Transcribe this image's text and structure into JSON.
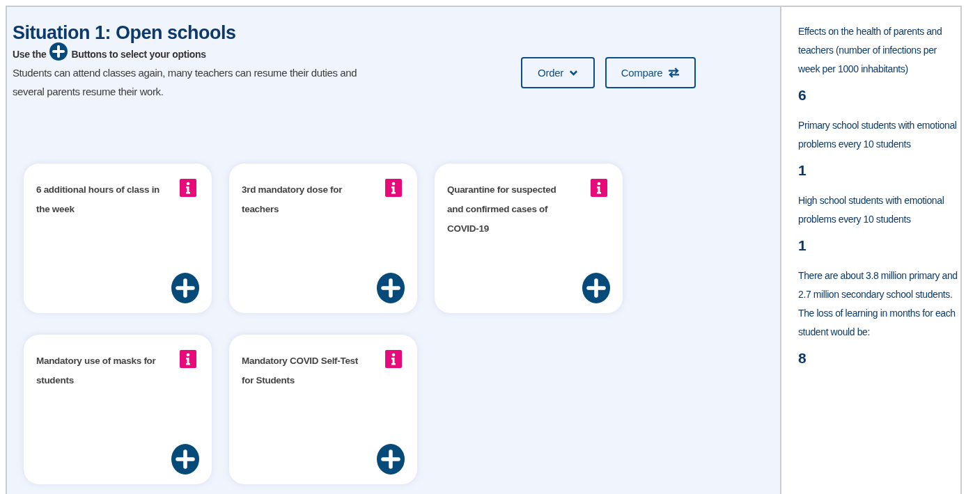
{
  "heading": "Situation 1: Open schools",
  "instruction": {
    "before": "Use the",
    "after": "Buttons to select your options"
  },
  "description": "Students can attend classes again, many teachers can resume their duties and several parents resume their work.",
  "buttons": [
    {
      "label": "Order",
      "kind": "dropdown"
    },
    {
      "label": "Compare",
      "kind": "swap"
    }
  ],
  "options": [
    {
      "title": "6 additional hours of class in the week"
    },
    {
      "title": "3rd mandatory dose for teachers"
    },
    {
      "title": "Quarantine for suspected and confirmed cases of COVID-19"
    },
    {
      "title": "Mandatory use of masks for students"
    },
    {
      "title": "Mandatory COVID Self-Test for Students"
    }
  ],
  "effects": [
    {
      "label": "Effects on the health of parents and teachers (number of infections per week per 1000 inhabitants)",
      "value": "6"
    },
    {
      "label": "Primary school students with emotional problems every 10 students",
      "value": "1"
    },
    {
      "label": "High school students with emotional problems every 10 students",
      "value": "1"
    },
    {
      "label": "There are about 3.8 million primary and 2.7 million secondary school students. The loss of learning in months for each student would be:",
      "value": "8"
    }
  ]
}
